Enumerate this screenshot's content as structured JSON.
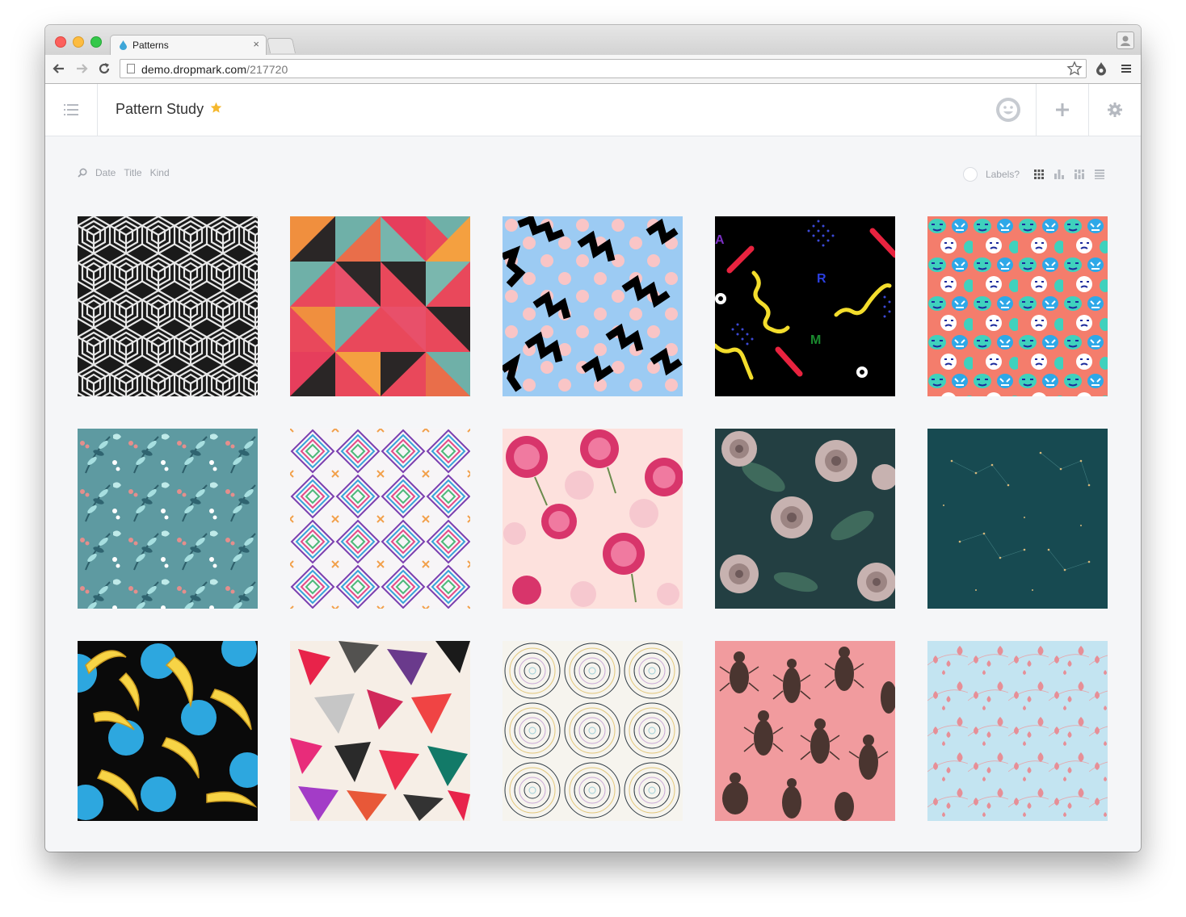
{
  "browser": {
    "tab_title": "Patterns",
    "tab_close": "×",
    "url_host": "demo.dropmark.com",
    "url_path": "/217720"
  },
  "header": {
    "collection_title": "Pattern Study",
    "icons": [
      "list-icon",
      "smiley-avatar-icon",
      "plus-icon",
      "gear-icon"
    ]
  },
  "sort": {
    "date": "Date",
    "title": "Title",
    "kind": "Kind"
  },
  "view": {
    "labels": "Labels?",
    "modes": [
      "grid-view-icon",
      "bar-view-icon",
      "mosaic-view-icon",
      "list-view-icon"
    ]
  },
  "items": [
    {
      "pattern": "black white hexagonal cube pattern"
    },
    {
      "pattern": "pink orange teal triangle blocks"
    },
    {
      "pattern": "blue zigzag with pink dots"
    },
    {
      "pattern": "black memphis squiggles"
    },
    {
      "pattern": "coral with cartoon faces"
    },
    {
      "pattern": "teal floral with berries"
    },
    {
      "pattern": "rainbow diamond lines"
    },
    {
      "pattern": "pink peonies"
    },
    {
      "pattern": "dark green roses"
    },
    {
      "pattern": "dark teal constellation"
    },
    {
      "pattern": "black bananas blue dots"
    },
    {
      "pattern": "watercolor triangles"
    },
    {
      "pattern": "concentric circles"
    },
    {
      "pattern": "beetles on pink"
    },
    {
      "pattern": "light blue pink drops"
    }
  ]
}
